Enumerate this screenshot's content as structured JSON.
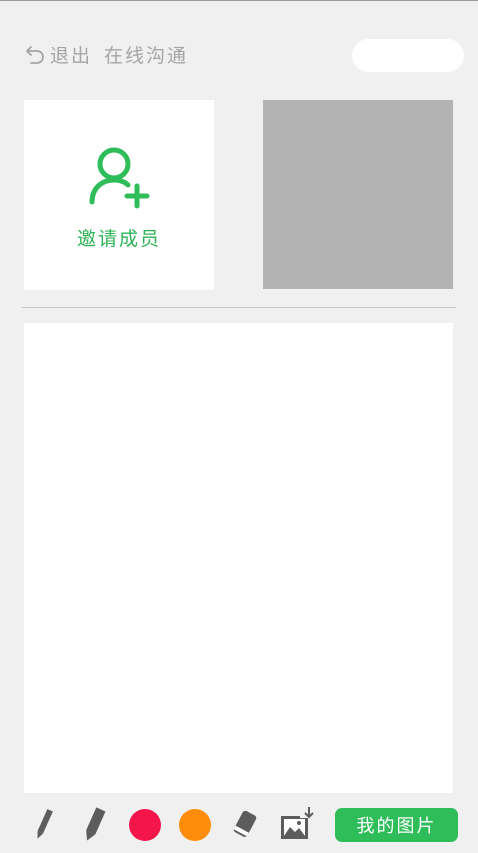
{
  "header": {
    "back_label": "退出",
    "title": "在线沟通"
  },
  "invite": {
    "label": "邀请成员"
  },
  "toolbar": {
    "colors": [
      "#f4164a",
      "#fc8c0a"
    ],
    "my_pictures_label": "我的图片"
  },
  "theme": {
    "accent": "#2ebd59",
    "muted_text": "#a5a5a5",
    "video_placeholder": "#b3b3b3"
  }
}
